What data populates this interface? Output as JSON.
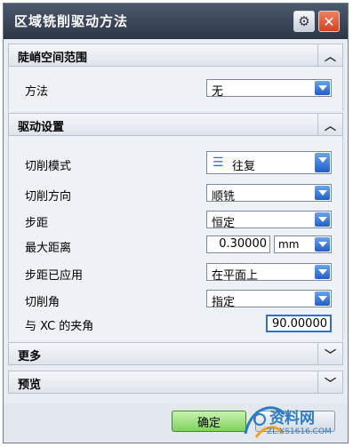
{
  "dialog": {
    "title": "区域铣削驱动方法"
  },
  "sections": {
    "steep": {
      "label": "陡峭空间范围",
      "method_label": "方法",
      "method_value": "无"
    },
    "drive": {
      "label": "驱动设置",
      "cut_pattern_label": "切削模式",
      "cut_pattern_value": "往复",
      "cut_direction_label": "切削方向",
      "cut_direction_value": "顺铣",
      "stepover_label": "步距",
      "stepover_value": "恒定",
      "max_distance_label": "最大距离",
      "max_distance_value": "0.30000",
      "max_distance_unit": "mm",
      "stepover_applied_label": "步距已应用",
      "stepover_applied_value": "在平面上",
      "cut_angle_label": "切削角",
      "cut_angle_value": "指定",
      "xc_angle_label": "与 XC 的夹角",
      "xc_angle_value": "90.00000"
    },
    "more": {
      "label": "更多"
    },
    "preview": {
      "label": "预览"
    }
  },
  "footer": {
    "ok_label": "确定"
  },
  "watermark": {
    "text": "资料网",
    "url": "ZL.XS1616.COM"
  },
  "icons": {
    "gear": "gear-icon",
    "close": "close-icon",
    "collapse": "chevron-up-icon",
    "expand": "chevron-down-icon"
  },
  "colors": {
    "titlebar": "#3a4657",
    "dropdown_arrow": "#2f6fd6",
    "ok_button": "#7fd35c",
    "close_button": "#e05a2e"
  }
}
